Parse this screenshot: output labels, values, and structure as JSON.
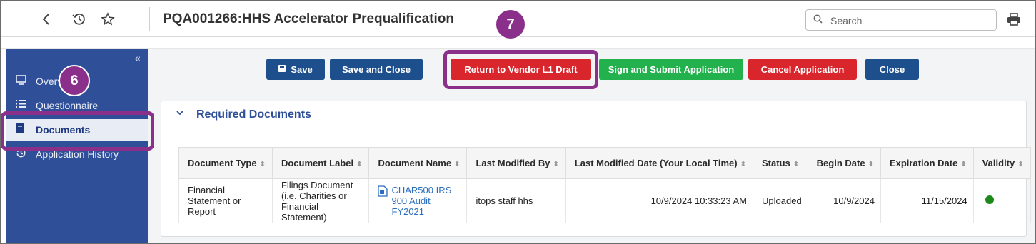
{
  "topbar": {
    "title": "PQA001266:HHS Accelerator Prequalification",
    "search_placeholder": "Search",
    "icons": [
      "back-icon",
      "history-icon",
      "star-icon",
      "search-icon",
      "print-icon"
    ]
  },
  "sidebar": {
    "collapse_glyph": "«",
    "items": [
      {
        "label": "Overview",
        "icon": "monitor-icon"
      },
      {
        "label": "Questionnaire",
        "icon": "list-icon"
      },
      {
        "label": "Documents",
        "icon": "book-icon",
        "active": true
      },
      {
        "label": "Application History",
        "icon": "history-icon"
      }
    ]
  },
  "toolbar": {
    "save": "Save",
    "save_and_close": "Save and Close",
    "return_to_vendor": "Return to Vendor L1 Draft",
    "sign_and_submit": "Sign and Submit Application",
    "cancel_application": "Cancel Application",
    "close": "Close"
  },
  "section": {
    "title": "Required Documents"
  },
  "table": {
    "columns": [
      "Document Type",
      "Document Label",
      "Document Name",
      "Last Modified By",
      "Last Modified Date (Your Local Time)",
      "Status",
      "Begin Date",
      "Expiration Date",
      "Validity"
    ],
    "rows": [
      {
        "document_type": [
          "Financial",
          "Statement or",
          "Report"
        ],
        "document_label": [
          "Filings Document",
          "(i.e. Charities or",
          "Financial Statement)"
        ],
        "document_name": [
          "CHAR500 IRS",
          "900 Audit FY2021"
        ],
        "last_modified_by": "itops staff hhs",
        "last_modified_date": "10/9/2024 10:33:23 AM",
        "status": "Uploaded",
        "begin_date": "10/9/2024",
        "expiration_date": "11/15/2024",
        "validity": "valid"
      }
    ]
  },
  "callouts": {
    "six": "6",
    "seven": "7"
  },
  "colors": {
    "sidebar_bg": "#2f4f98",
    "primary_button": "#1d4f8c",
    "danger_button": "#d9262d",
    "success_button": "#22b14c",
    "callout": "#8a2f8a",
    "validity_ok": "#1b8a1b"
  }
}
